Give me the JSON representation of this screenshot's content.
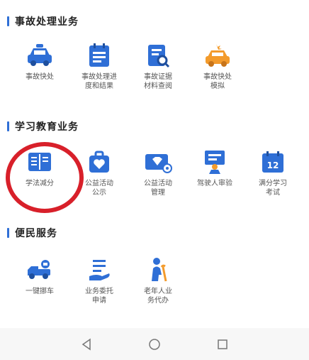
{
  "sections": [
    {
      "title": "事故处理业务"
    },
    {
      "title": "学习教育业务"
    },
    {
      "title": "便民服务"
    }
  ],
  "accident_items": [
    {
      "label": "事故快处",
      "icon": "police-car-icon"
    },
    {
      "label": "事故处理进\n度和结果",
      "icon": "calendar-doc-icon"
    },
    {
      "label": "事故证据\n材料查阅",
      "icon": "search-doc-icon"
    },
    {
      "label": "事故快处\n模拟",
      "icon": "car-crash-icon"
    }
  ],
  "education_items": [
    {
      "label": "学法减分",
      "icon": "book-icon"
    },
    {
      "label": "公益活动\n公示",
      "icon": "heart-bag-icon"
    },
    {
      "label": "公益活动\n管理",
      "icon": "diamond-card-icon"
    },
    {
      "label": "驾驶人审验",
      "icon": "board-person-icon"
    },
    {
      "label": "满分学习\n考试",
      "icon": "calendar-12-icon"
    }
  ],
  "convenience_items": [
    {
      "label": "一键挪车",
      "icon": "tow-truck-icon"
    },
    {
      "label": "业务委托\n申请",
      "icon": "hand-list-icon"
    },
    {
      "label": "老年人业\n务代办",
      "icon": "elderly-icon"
    }
  ],
  "colors": {
    "primary": "#2f6fd6",
    "accent": "#f39b2c",
    "highlight": "#d8202a"
  }
}
